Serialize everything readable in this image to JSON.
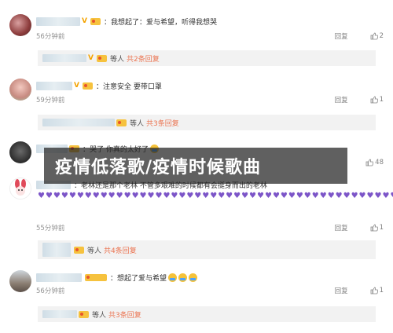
{
  "comments": [
    {
      "text": "：我想起了：爱与希望，听得我想哭",
      "time": "56分钟前",
      "reply": "回复",
      "likes": "2",
      "sub": {
        "text": "等人",
        "link": "共2条回复"
      }
    },
    {
      "text": "：注意安全 要带口罩",
      "time": "59分钟前",
      "reply": "回复",
      "likes": "1",
      "sub": {
        "text": "等人",
        "link": "共3条回复"
      }
    },
    {
      "text": "：哭了 你真的太好了",
      "time": "",
      "reply": "",
      "likes": "48"
    },
    {
      "text": "：老林还是那个老林 不管多艰难的时候都有会挺身而出的老林",
      "hearts": "♥♥♥♥♥♥♥♥♥♥♥♥♥♥♥♥♥♥♥♥♥♥♥♥♥♥♥♥♥♥♥♥♥♥♥♥♥♥♥♥♥♥♥♥♥♥♥♥♥♥",
      "time": "55分钟前",
      "reply": "回复",
      "likes": "1",
      "sub": {
        "text": "等人",
        "link": "共4条回复"
      }
    },
    {
      "text": "：想起了爱与希望",
      "time": "56分钟前",
      "reply": "回复",
      "likes": "1",
      "sub": {
        "text": "等人",
        "link": "共3条回复"
      }
    }
  ],
  "overlay_title": "疫情低落歌/疫情时候歌曲",
  "colors": {
    "link": "#eb7350",
    "overlay_bg": "#232323",
    "heart": "#7c55c8"
  },
  "icons": {
    "like": "thumbs-up-icon",
    "verified": "v-badge-icon",
    "level": "level-badge-icon",
    "heart": "purple-heart-icon"
  }
}
